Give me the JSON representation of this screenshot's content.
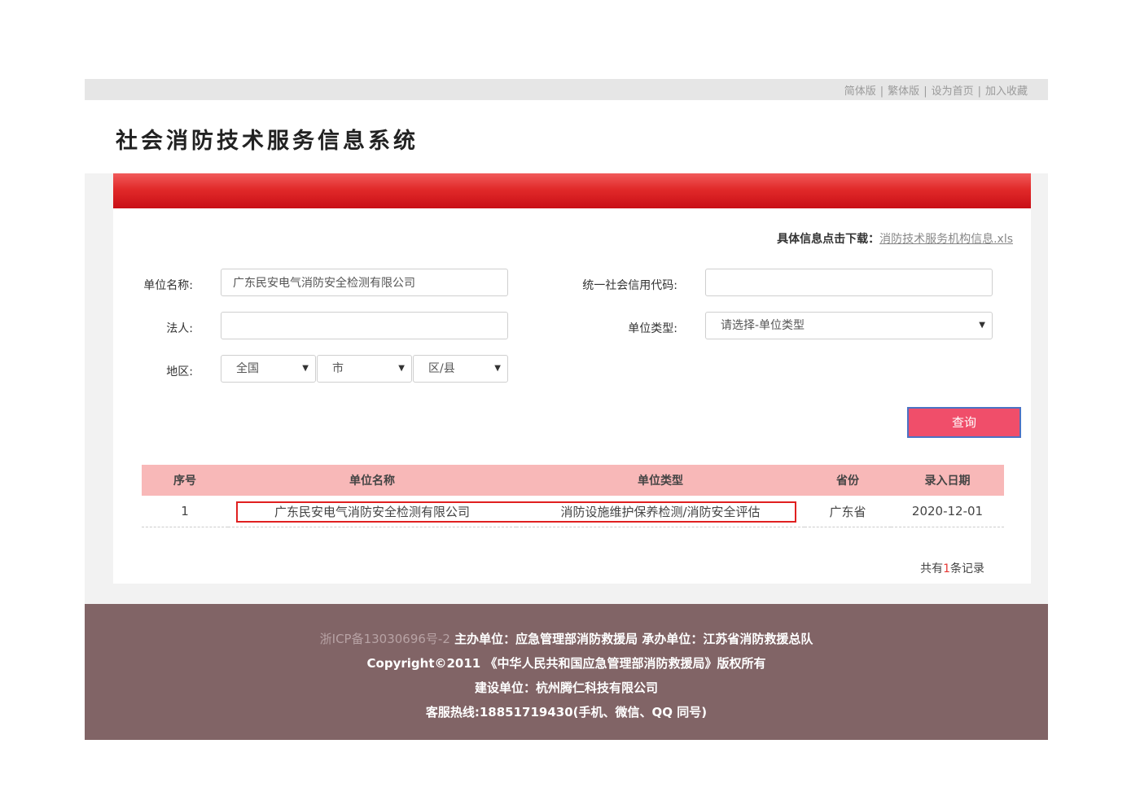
{
  "top_links": [
    "简体版",
    "繁体版",
    "设为首页",
    "加入收藏"
  ],
  "site_title": "社会消防技术服务信息系统",
  "download": {
    "label": "具体信息点击下载：",
    "file": "消防技术服务机构信息.xls"
  },
  "form": {
    "unit_name_label": "单位名称:",
    "unit_name_value": "广东民安电气消防安全检测有限公司",
    "credit_code_label": "统一社会信用代码:",
    "credit_code_value": "",
    "legal_person_label": "法人:",
    "legal_person_value": "",
    "unit_type_label": "单位类型:",
    "unit_type_value": "请选择-单位类型",
    "region_label": "地区:",
    "province_value": "全国",
    "city_value": "市",
    "district_value": "区/县",
    "query_button": "查询"
  },
  "table": {
    "headers": [
      "序号",
      "单位名称",
      "单位类型",
      "省份",
      "录入日期"
    ],
    "rows": [
      [
        "1",
        "广东民安电气消防安全检测有限公司",
        "消防设施维护保养检测/消防安全评估",
        "广东省",
        "2020-12-01"
      ]
    ]
  },
  "record": {
    "prefix": "共有",
    "count": "1",
    "suffix": "条记录"
  },
  "footer": {
    "icp": "浙ICP备13030696号-2",
    "line1_rest": " 主办单位：应急管理部消防救援局 承办单位：江苏省消防救援总队",
    "line2": "Copyright©2011 《中华人民共和国应急管理部消防救援局》版权所有",
    "line3": "建设单位：杭州腾仁科技有限公司",
    "line4": "客服热线:18851719430(手机、微信、QQ 同号)"
  },
  "colors": {
    "red_bar": "#d81e24",
    "table_header": "#f8b8b8",
    "query_button": "#f04e6a",
    "footer_bg": "#816466",
    "highlight_border": "#e02020"
  }
}
